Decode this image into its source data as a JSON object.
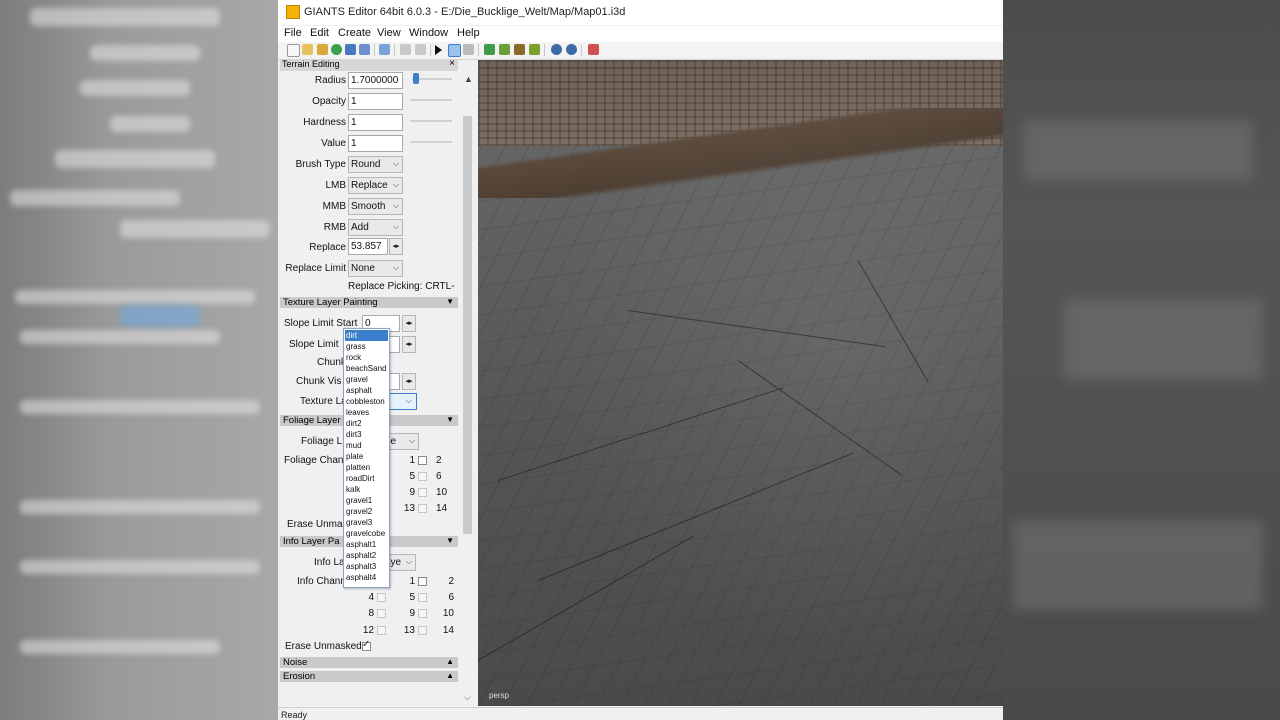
{
  "window": {
    "title": "GIANTS Editor 64bit 6.0.3 - E:/Die_Bucklige_Welt/Map/Map01.i3d"
  },
  "menu": [
    "File",
    "Edit",
    "Create",
    "View",
    "Window",
    "Help"
  ],
  "panel": {
    "title": "Terrain Editing",
    "close": "×",
    "terrain": {
      "radius_label": "Radius",
      "radius_value": "1.7000000",
      "opacity_label": "Opacity",
      "opacity_value": "1",
      "hardness_label": "Hardness",
      "hardness_value": "1",
      "value_label": "Value",
      "value_value": "1",
      "brush_type_label": "Brush Type",
      "brush_type_value": "Round",
      "lmb_label": "LMB",
      "lmb_value": "Replace",
      "mmb_label": "MMB",
      "mmb_value": "Smooth",
      "rmb_label": "RMB",
      "rmb_value": "Add",
      "replace_label": "Replace",
      "replace_value": "53.857",
      "replace_limit_label": "Replace Limit",
      "replace_limit_value": "None",
      "replace_picking": "Replace Picking: CRTL-"
    },
    "texture": {
      "section": "Texture Layer Painting",
      "slope_start_label": "Slope Limit Start",
      "slope_start_value": "0",
      "slope_limit_label": "Slope Limit",
      "chunk_label": "Chunk",
      "chunk_vis_label": "Chunk Vis",
      "texture_layer_label": "Texture La"
    },
    "foliage": {
      "section": "Foliage Layer",
      "foliage_layer_label": "Foliage L",
      "foliage_layer_value": "pe",
      "foliage_channel_label": "Foliage Chan",
      "channels": [
        "1",
        "2",
        "5",
        "6",
        "9",
        "10",
        "13",
        "14"
      ],
      "erase_unmasked_label": "Erase Unmas"
    },
    "info": {
      "section": "Info Layer Pa",
      "info_layer_label": "Info La",
      "info_layer_value": "aye",
      "info_channel_label": "Info Chann",
      "channels": [
        "1",
        "2",
        "4",
        "5",
        "6",
        "8",
        "9",
        "10",
        "12",
        "13",
        "14"
      ],
      "erase_unmasked_label": "Erase Unmasked"
    },
    "noise_section": "Noise",
    "erosion_section": "Erosion"
  },
  "dropdown": {
    "items": [
      "dirt",
      "grass",
      "rock",
      "beachSand",
      "gravel",
      "asphalt",
      "cobbleston",
      "leaves",
      "dirt2",
      "dirt3",
      "mud",
      "plate",
      "platten",
      "roadDirt",
      "kalk",
      "gravel1",
      "gravel2",
      "gravel3",
      "gravelcobe",
      "asphalt1",
      "asphalt2",
      "asphalt3",
      "asphalt4"
    ],
    "selected": "dirt"
  },
  "viewport": {
    "camera_label": "persp"
  },
  "status": {
    "text": "Ready"
  }
}
